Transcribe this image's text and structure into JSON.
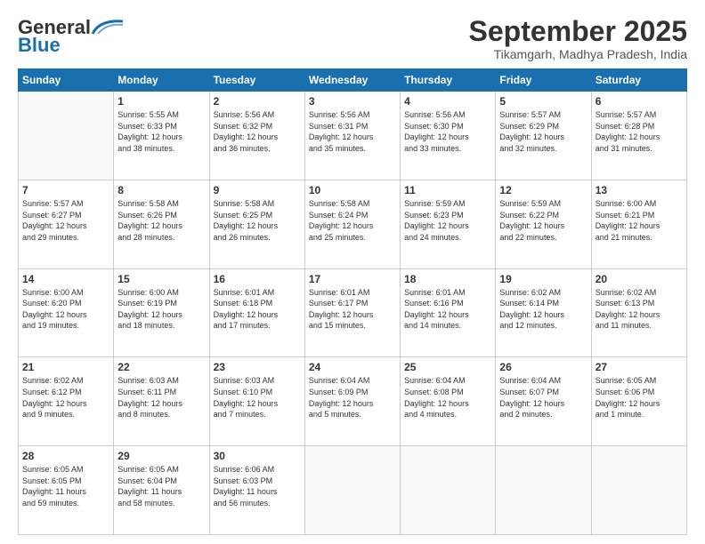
{
  "header": {
    "logo_general": "General",
    "logo_blue": "Blue",
    "month_title": "September 2025",
    "location": "Tikamgarh, Madhya Pradesh, India"
  },
  "days_of_week": [
    "Sunday",
    "Monday",
    "Tuesday",
    "Wednesday",
    "Thursday",
    "Friday",
    "Saturday"
  ],
  "weeks": [
    [
      {
        "day": "",
        "info": ""
      },
      {
        "day": "1",
        "info": "Sunrise: 5:55 AM\nSunset: 6:33 PM\nDaylight: 12 hours\nand 38 minutes."
      },
      {
        "day": "2",
        "info": "Sunrise: 5:56 AM\nSunset: 6:32 PM\nDaylight: 12 hours\nand 36 minutes."
      },
      {
        "day": "3",
        "info": "Sunrise: 5:56 AM\nSunset: 6:31 PM\nDaylight: 12 hours\nand 35 minutes."
      },
      {
        "day": "4",
        "info": "Sunrise: 5:56 AM\nSunset: 6:30 PM\nDaylight: 12 hours\nand 33 minutes."
      },
      {
        "day": "5",
        "info": "Sunrise: 5:57 AM\nSunset: 6:29 PM\nDaylight: 12 hours\nand 32 minutes."
      },
      {
        "day": "6",
        "info": "Sunrise: 5:57 AM\nSunset: 6:28 PM\nDaylight: 12 hours\nand 31 minutes."
      }
    ],
    [
      {
        "day": "7",
        "info": "Sunrise: 5:57 AM\nSunset: 6:27 PM\nDaylight: 12 hours\nand 29 minutes."
      },
      {
        "day": "8",
        "info": "Sunrise: 5:58 AM\nSunset: 6:26 PM\nDaylight: 12 hours\nand 28 minutes."
      },
      {
        "day": "9",
        "info": "Sunrise: 5:58 AM\nSunset: 6:25 PM\nDaylight: 12 hours\nand 26 minutes."
      },
      {
        "day": "10",
        "info": "Sunrise: 5:58 AM\nSunset: 6:24 PM\nDaylight: 12 hours\nand 25 minutes."
      },
      {
        "day": "11",
        "info": "Sunrise: 5:59 AM\nSunset: 6:23 PM\nDaylight: 12 hours\nand 24 minutes."
      },
      {
        "day": "12",
        "info": "Sunrise: 5:59 AM\nSunset: 6:22 PM\nDaylight: 12 hours\nand 22 minutes."
      },
      {
        "day": "13",
        "info": "Sunrise: 6:00 AM\nSunset: 6:21 PM\nDaylight: 12 hours\nand 21 minutes."
      }
    ],
    [
      {
        "day": "14",
        "info": "Sunrise: 6:00 AM\nSunset: 6:20 PM\nDaylight: 12 hours\nand 19 minutes."
      },
      {
        "day": "15",
        "info": "Sunrise: 6:00 AM\nSunset: 6:19 PM\nDaylight: 12 hours\nand 18 minutes."
      },
      {
        "day": "16",
        "info": "Sunrise: 6:01 AM\nSunset: 6:18 PM\nDaylight: 12 hours\nand 17 minutes."
      },
      {
        "day": "17",
        "info": "Sunrise: 6:01 AM\nSunset: 6:17 PM\nDaylight: 12 hours\nand 15 minutes."
      },
      {
        "day": "18",
        "info": "Sunrise: 6:01 AM\nSunset: 6:16 PM\nDaylight: 12 hours\nand 14 minutes."
      },
      {
        "day": "19",
        "info": "Sunrise: 6:02 AM\nSunset: 6:14 PM\nDaylight: 12 hours\nand 12 minutes."
      },
      {
        "day": "20",
        "info": "Sunrise: 6:02 AM\nSunset: 6:13 PM\nDaylight: 12 hours\nand 11 minutes."
      }
    ],
    [
      {
        "day": "21",
        "info": "Sunrise: 6:02 AM\nSunset: 6:12 PM\nDaylight: 12 hours\nand 9 minutes."
      },
      {
        "day": "22",
        "info": "Sunrise: 6:03 AM\nSunset: 6:11 PM\nDaylight: 12 hours\nand 8 minutes."
      },
      {
        "day": "23",
        "info": "Sunrise: 6:03 AM\nSunset: 6:10 PM\nDaylight: 12 hours\nand 7 minutes."
      },
      {
        "day": "24",
        "info": "Sunrise: 6:04 AM\nSunset: 6:09 PM\nDaylight: 12 hours\nand 5 minutes."
      },
      {
        "day": "25",
        "info": "Sunrise: 6:04 AM\nSunset: 6:08 PM\nDaylight: 12 hours\nand 4 minutes."
      },
      {
        "day": "26",
        "info": "Sunrise: 6:04 AM\nSunset: 6:07 PM\nDaylight: 12 hours\nand 2 minutes."
      },
      {
        "day": "27",
        "info": "Sunrise: 6:05 AM\nSunset: 6:06 PM\nDaylight: 12 hours\nand 1 minute."
      }
    ],
    [
      {
        "day": "28",
        "info": "Sunrise: 6:05 AM\nSunset: 6:05 PM\nDaylight: 11 hours\nand 59 minutes."
      },
      {
        "day": "29",
        "info": "Sunrise: 6:05 AM\nSunset: 6:04 PM\nDaylight: 11 hours\nand 58 minutes."
      },
      {
        "day": "30",
        "info": "Sunrise: 6:06 AM\nSunset: 6:03 PM\nDaylight: 11 hours\nand 56 minutes."
      },
      {
        "day": "",
        "info": ""
      },
      {
        "day": "",
        "info": ""
      },
      {
        "day": "",
        "info": ""
      },
      {
        "day": "",
        "info": ""
      }
    ]
  ]
}
